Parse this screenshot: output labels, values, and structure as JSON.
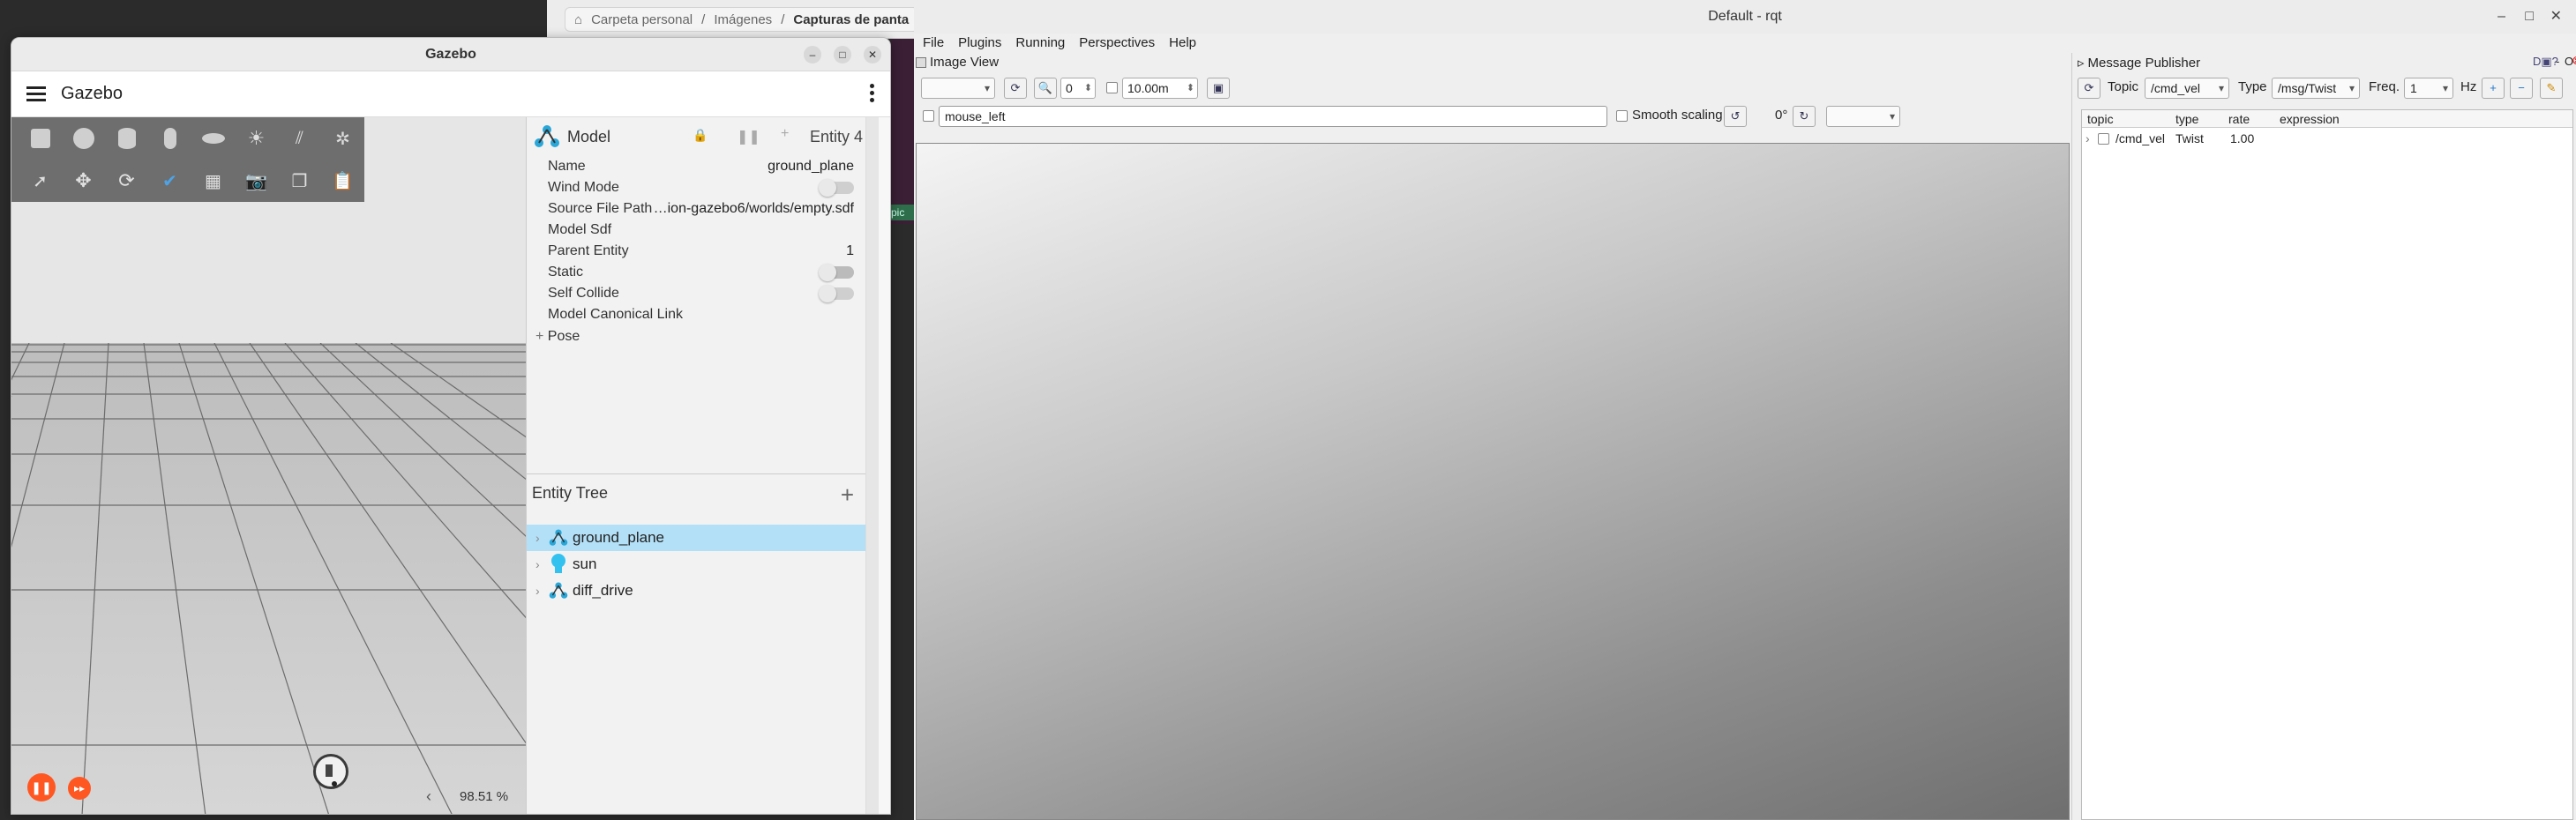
{
  "file_manager": {
    "breadcrumb": [
      "Carpeta personal",
      "Imágenes",
      "Capturas de panta"
    ]
  },
  "background_tag": "pic",
  "gazebo": {
    "window_title": "Gazebo",
    "header_title": "Gazebo",
    "component_inspector": {
      "type_label": "Model",
      "entity_label": "Entity 4",
      "properties": [
        {
          "name": "Name",
          "value": "ground_plane"
        },
        {
          "name": "Wind Mode",
          "toggle": false
        },
        {
          "name": "Source File Path",
          "value": "…ion-gazebo6/worlds/empty.sdf"
        },
        {
          "name": "Model Sdf",
          "value": ""
        },
        {
          "name": "Parent Entity",
          "value": "1"
        },
        {
          "name": "Static",
          "toggle": true
        },
        {
          "name": "Self Collide",
          "toggle": false
        },
        {
          "name": "Model Canonical Link",
          "value": ""
        }
      ],
      "pose_label": "Pose"
    },
    "entity_tree": {
      "title": "Entity Tree",
      "items": [
        {
          "label": "ground_plane",
          "icon": "model-icon",
          "selected": true
        },
        {
          "label": "sun",
          "icon": "light-bulb-icon",
          "selected": false
        },
        {
          "label": "diff_drive",
          "icon": "model-icon",
          "selected": false
        }
      ]
    },
    "rtf": "98.51 %"
  },
  "rqt": {
    "window_title": "Default - rqt",
    "menu": [
      "File",
      "Plugins",
      "Running",
      "Perspectives",
      "Help"
    ],
    "image_view": {
      "title": "Image View",
      "zoom_value": "0",
      "max_range": "10.00m",
      "topic_field": "mouse_left",
      "smooth_scaling": "Smooth scaling",
      "rotation": "0°"
    },
    "message_publisher": {
      "title": "Message Publisher",
      "topic_label": "Topic",
      "topic_value": "/cmd_vel",
      "type_label": "Type",
      "type_value": "/msg/Twist",
      "freq_label": "Freq.",
      "freq_value": "1",
      "hz_label": "Hz",
      "columns": [
        "topic",
        "type",
        "rate",
        "expression"
      ],
      "rows": [
        {
          "topic": "/cmd_vel",
          "type": "Twist",
          "rate": "1.00",
          "expression": ""
        }
      ]
    }
  }
}
